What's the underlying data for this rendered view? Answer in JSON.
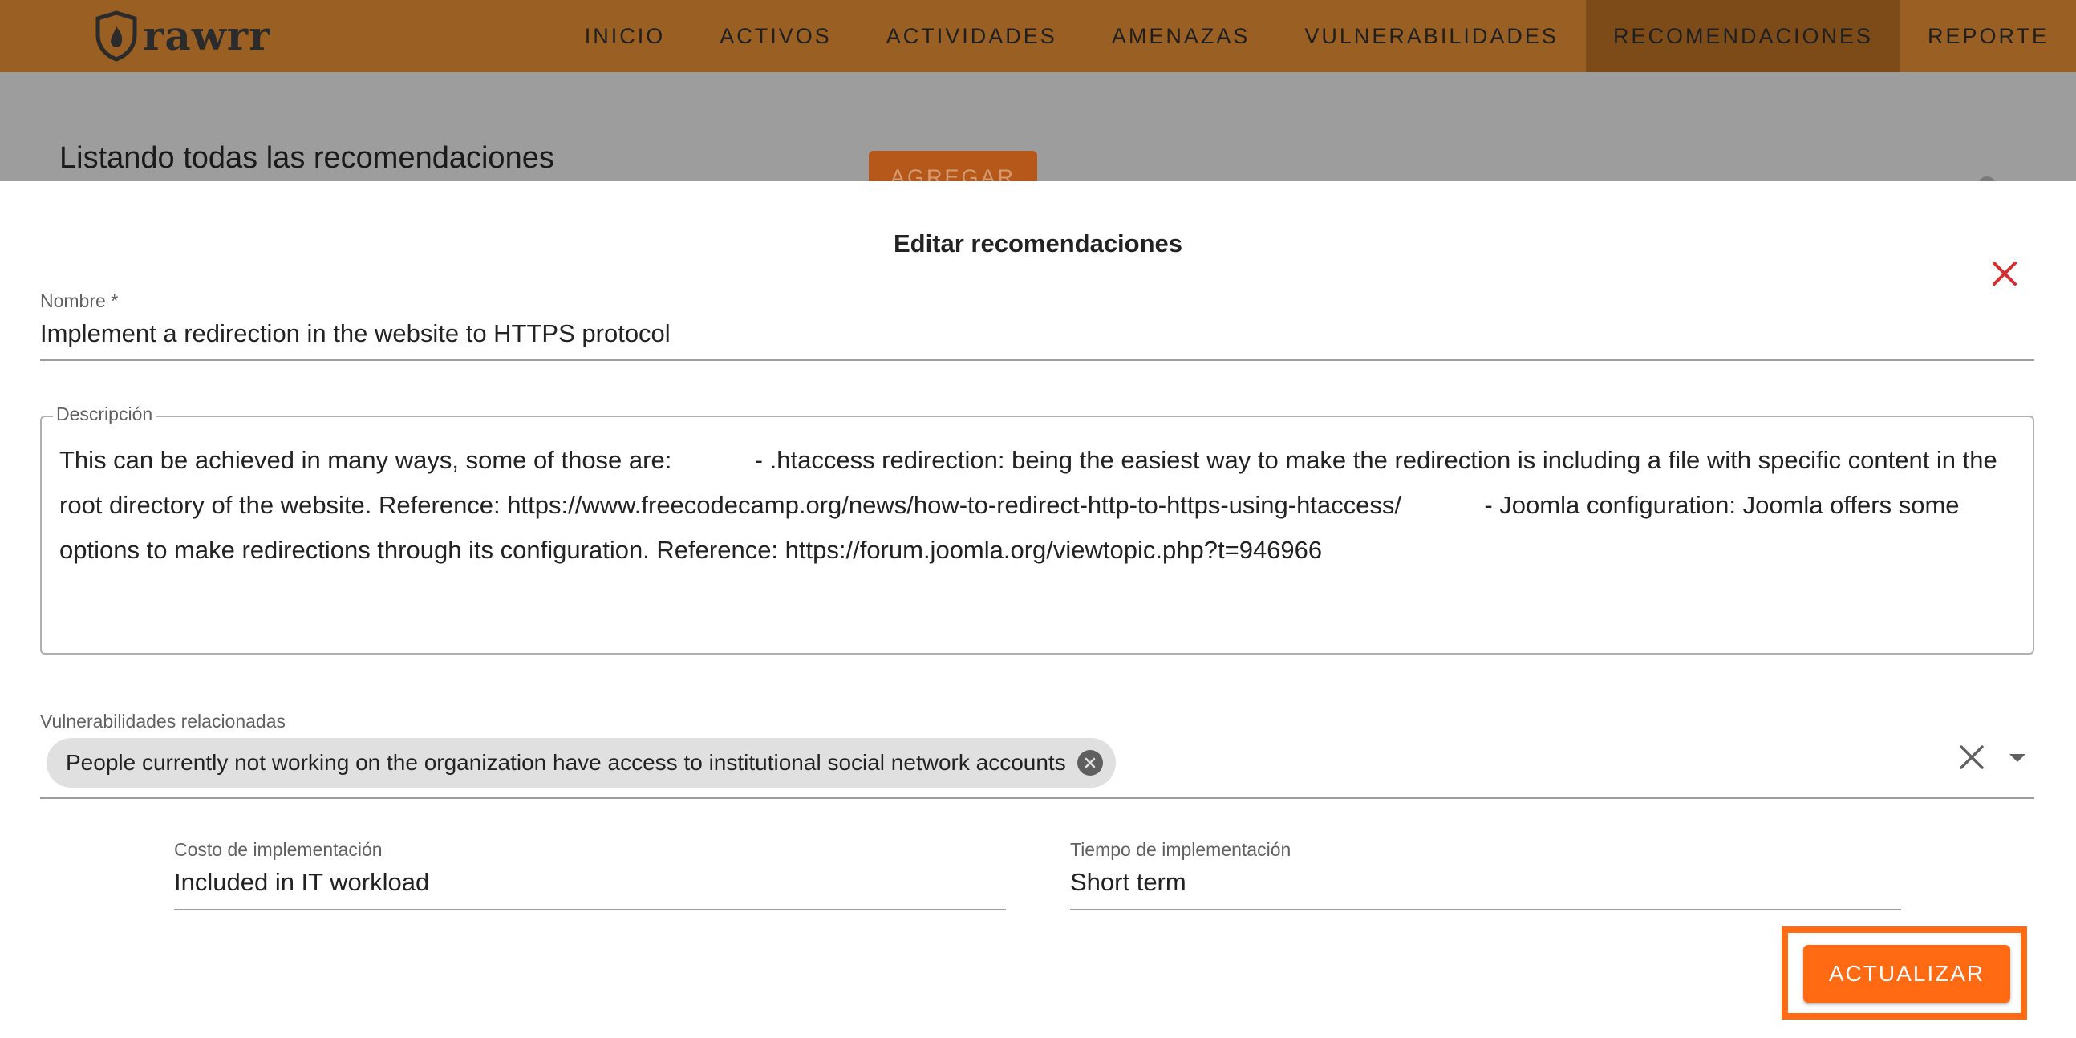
{
  "app": {
    "logo_text": "rawrr",
    "nav": [
      {
        "label": "INICIO"
      },
      {
        "label": "ACTIVOS"
      },
      {
        "label": "ACTIVIDADES"
      },
      {
        "label": "AMENAZAS"
      },
      {
        "label": "VULNERABILIDADES"
      },
      {
        "label": "RECOMENDACIONES",
        "active": true
      },
      {
        "label": "REPORTE"
      }
    ]
  },
  "page": {
    "title": "Listando todas las recomendaciones",
    "add_label": "AGREGAR"
  },
  "dialog": {
    "title": "Editar recomendaciones",
    "name": {
      "label": "Nombre *",
      "value": "Implement a redirection in the website to HTTPS protocol"
    },
    "description": {
      "label": "Descripción",
      "value": "This can be achieved in many ways, some of those are:            - .htaccess redirection: being the easiest way to make the redirection is including a file with specific content in the root directory of the website. Reference: https://www.freecodecamp.org/news/how-to-redirect-http-to-https-using-htaccess/            - Joomla configuration: Joomla offers some options to make redirections through its configuration. Reference: https://forum.joomla.org/viewtopic.php?t=946966"
    },
    "related_vulnerabilities": {
      "label": "Vulnerabilidades relacionadas",
      "chips": [
        "People currently not working on the organization have access to institutional social network accounts"
      ]
    },
    "cost": {
      "label": "Costo de implementación",
      "value": "Included in IT workload"
    },
    "time": {
      "label": "Tiempo de implementación",
      "value": "Short term"
    },
    "submit_label": "ACTUALIZAR"
  },
  "colors": {
    "navbar": "#9a5f23",
    "nav_active": "#7d4b18",
    "accent": "#ff6a13",
    "close_icon": "#d32f2f"
  },
  "icons": {
    "logo": "shield-flame-icon",
    "close": "close-icon",
    "chip_delete": "cancel-circle-icon",
    "clear": "clear-icon",
    "dropdown": "arrow-drop-down-icon"
  }
}
